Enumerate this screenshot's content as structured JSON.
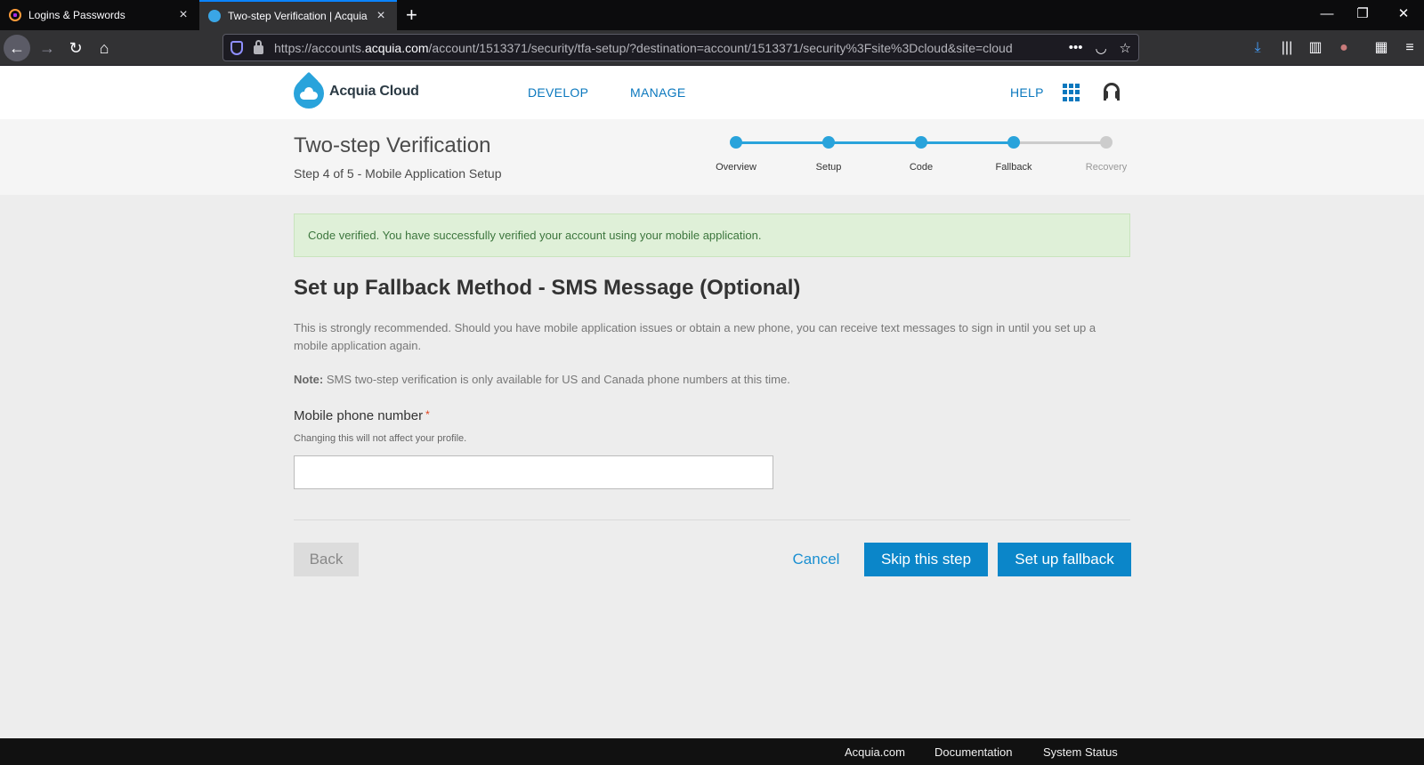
{
  "browser": {
    "tabs": [
      {
        "title": "Logins & Passwords",
        "active": false
      },
      {
        "title": "Two-step Verification | Acquia",
        "active": true
      }
    ],
    "url_prefix": "https://accounts.",
    "url_domain": "acquia.com",
    "url_path": "/account/1513371/security/tfa-setup/?destination=account/1513371/security%3Fsite%3Dcloud&site=cloud",
    "icons": {
      "tab_close": "×",
      "new_tab": "+",
      "minimize": "—",
      "restore": "❐",
      "close": "✕",
      "back": "←",
      "forward": "→",
      "reload": "↻",
      "home": "⌂",
      "more": "•••",
      "pocket": "◡",
      "star": "☆",
      "download": "⤓",
      "library": "|||",
      "sidebar": "▥",
      "account": "●",
      "extensions": "▦",
      "menu": "≡"
    }
  },
  "site": {
    "brand": "Acquia Cloud",
    "nav": {
      "develop": "DEVELOP",
      "manage": "MANAGE",
      "help": "HELP"
    }
  },
  "header": {
    "title": "Two-step Verification",
    "subtitle": "Step 4 of 5 - Mobile Application Setup"
  },
  "stepper": {
    "steps": [
      {
        "label": "Overview",
        "complete": true
      },
      {
        "label": "Setup",
        "complete": true
      },
      {
        "label": "Code",
        "complete": true
      },
      {
        "label": "Fallback",
        "complete": true
      },
      {
        "label": "Recovery",
        "complete": false
      }
    ],
    "active_color": "#29a3db",
    "inactive_color": "#cccccc"
  },
  "alert": {
    "message": "Code verified. You have successfully verified your account using your mobile application."
  },
  "main": {
    "section_title": "Set up Fallback Method - SMS Message (Optional)",
    "description": "This is strongly recommended. Should you have mobile application issues or obtain a new phone, you can receive text messages to sign in until you set up a mobile application again.",
    "note_label": "Note:",
    "note_text": " SMS two-step verification is only available for US and Canada phone numbers at this time.",
    "phone_label": "Mobile phone number",
    "required_mark": "*",
    "phone_help": "Changing this will not affect your profile.",
    "phone_value": ""
  },
  "actions": {
    "back": "Back",
    "cancel": "Cancel",
    "skip": "Skip this step",
    "setup": "Set up fallback"
  },
  "footer": {
    "links": [
      "Acquia.com",
      "Documentation",
      "System Status"
    ]
  }
}
